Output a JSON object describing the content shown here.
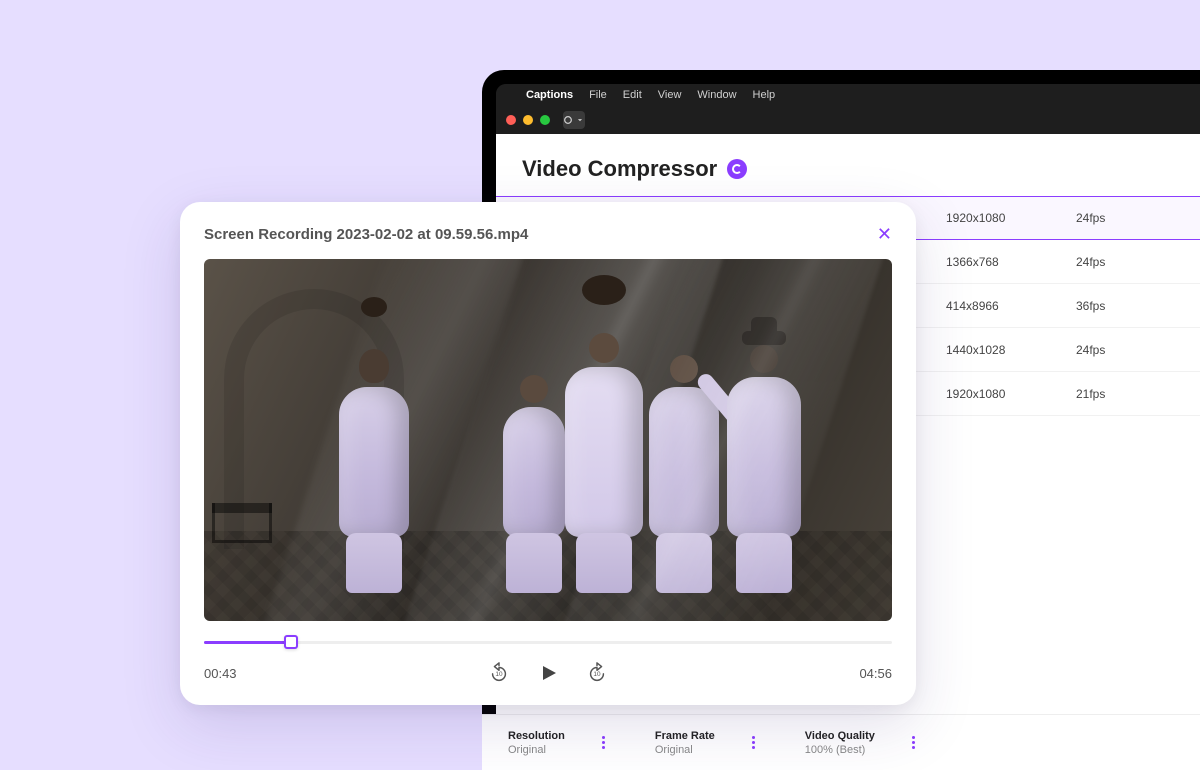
{
  "menubar": {
    "app": "Captions",
    "items": [
      "File",
      "Edit",
      "View",
      "Window",
      "Help"
    ]
  },
  "app": {
    "title": "Video Compressor"
  },
  "files": [
    {
      "resolution": "1920x1080",
      "fps": "24fps",
      "selected": true
    },
    {
      "resolution": "1366x768",
      "fps": "24fps",
      "selected": false
    },
    {
      "resolution": "414x8966",
      "fps": "36fps",
      "selected": false
    },
    {
      "resolution": "1440x1028",
      "fps": "24fps",
      "selected": false
    },
    {
      "resolution": "1920x1080",
      "fps": "21fps",
      "selected": false
    }
  ],
  "settings": {
    "resolution": {
      "label": "Resolution",
      "value": "Original"
    },
    "framerate": {
      "label": "Frame Rate",
      "value": "Original"
    },
    "quality": {
      "label": "Video Quality",
      "value": "100% (Best)"
    }
  },
  "player": {
    "filename": "Screen Recording 2023-02-02 at 09.59.56.mp4",
    "current_time": "00:43",
    "duration": "04:56",
    "progress_pct": 12.7,
    "skip_seconds": "10"
  }
}
